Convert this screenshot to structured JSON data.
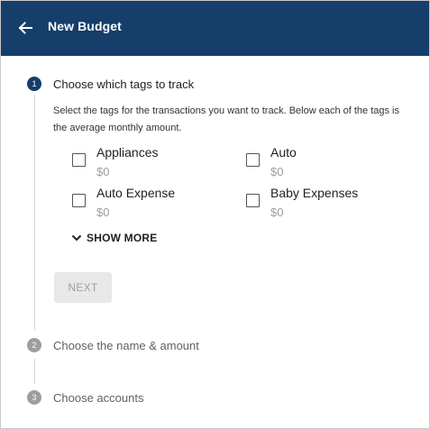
{
  "header": {
    "title": "New Budget",
    "back_icon": "arrow-left-icon",
    "background_color": "#153e6a"
  },
  "steps": [
    {
      "number": "1",
      "title": "Choose which tags to track",
      "state": "active"
    },
    {
      "number": "2",
      "title": "Choose the name & amount",
      "state": "inactive"
    },
    {
      "number": "3",
      "title": "Choose accounts",
      "state": "inactive"
    }
  ],
  "step1": {
    "description": "Select the tags for the transactions you want to track. Below each of the tags is the average monthly amount.",
    "tags": [
      {
        "name": "Appliances",
        "amount": "$0",
        "checked": false
      },
      {
        "name": "Auto",
        "amount": "$0",
        "checked": false
      },
      {
        "name": "Auto Expense",
        "amount": "$0",
        "checked": false
      },
      {
        "name": "Baby Expenses",
        "amount": "$0",
        "checked": false
      }
    ],
    "show_more_label": "SHOW MORE",
    "show_more_icon": "chevron-down-icon",
    "next_label": "NEXT",
    "next_disabled": true
  }
}
